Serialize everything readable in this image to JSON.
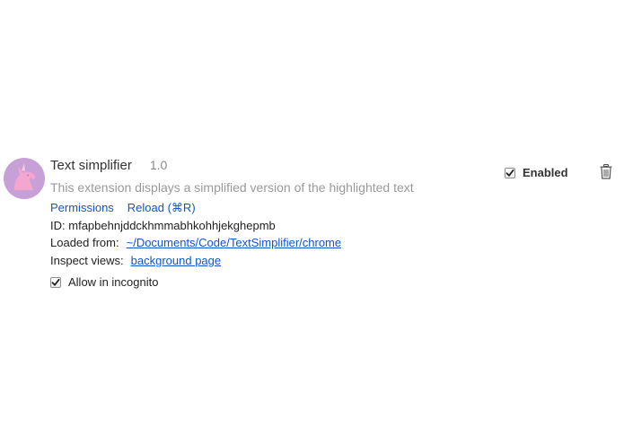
{
  "extension": {
    "name": "Text simplifier",
    "version": "1.0",
    "description": "This extension displays a simplified version of the highlighted text",
    "icon": "unicorn-icon",
    "colors": {
      "icon_bg": "#c6a0d6",
      "icon_fg": "#f4a6cf",
      "link": "#1155cc"
    },
    "links": {
      "permissions": "Permissions",
      "reload": "Reload (⌘R)"
    },
    "id_label": "ID:",
    "id_value": "mfapbehnjddckhmmabhkohhjekghepmb",
    "loaded_from_label": "Loaded from:",
    "loaded_from_path": "~/Documents/Code/TextSimplifier/chrome",
    "inspect_views_label": "Inspect views:",
    "inspect_views_link": "background page",
    "allow_incognito_label": "Allow in incognito",
    "allow_incognito_checked": true,
    "enabled_label": "Enabled",
    "enabled_checked": true,
    "remove_icon": "trash-icon"
  }
}
